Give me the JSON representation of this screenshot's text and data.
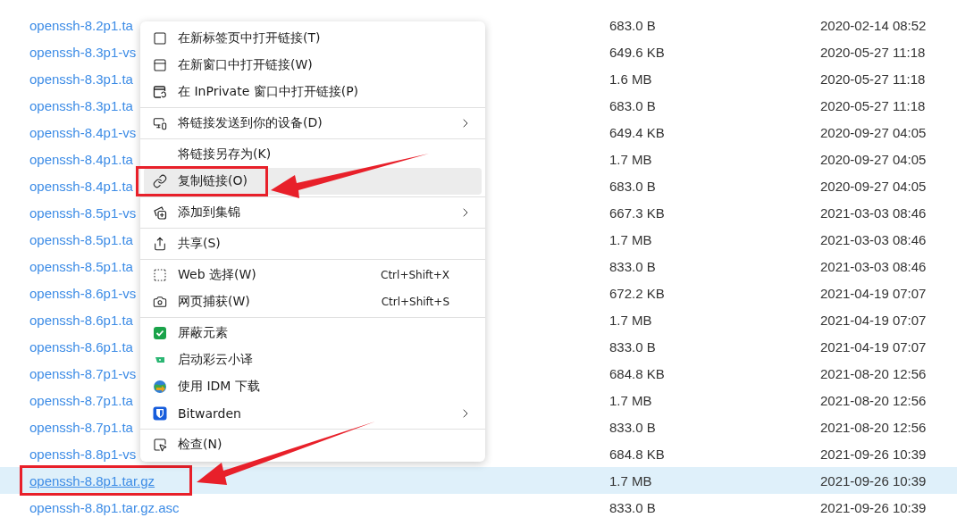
{
  "files": [
    {
      "name": "openssh-8.2p1.ta",
      "size": "683.0 B",
      "date": "2020-02-14 08:52",
      "selected": false
    },
    {
      "name": "openssh-8.3p1-vs",
      "size": "649.6 KB",
      "date": "2020-05-27 11:18",
      "selected": false
    },
    {
      "name": "openssh-8.3p1.ta",
      "size": "1.6 MB",
      "date": "2020-05-27 11:18",
      "selected": false
    },
    {
      "name": "openssh-8.3p1.ta",
      "size": "683.0 B",
      "date": "2020-05-27 11:18",
      "selected": false
    },
    {
      "name": "openssh-8.4p1-vs",
      "size": "649.4 KB",
      "date": "2020-09-27 04:05",
      "selected": false
    },
    {
      "name": "openssh-8.4p1.ta",
      "size": "1.7 MB",
      "date": "2020-09-27 04:05",
      "selected": false
    },
    {
      "name": "openssh-8.4p1.ta",
      "size": "683.0 B",
      "date": "2020-09-27 04:05",
      "selected": false
    },
    {
      "name": "openssh-8.5p1-vs",
      "size": "667.3 KB",
      "date": "2021-03-03 08:46",
      "selected": false
    },
    {
      "name": "openssh-8.5p1.ta",
      "size": "1.7 MB",
      "date": "2021-03-03 08:46",
      "selected": false
    },
    {
      "name": "openssh-8.5p1.ta",
      "size": "833.0 B",
      "date": "2021-03-03 08:46",
      "selected": false
    },
    {
      "name": "openssh-8.6p1-vs",
      "size": "672.2 KB",
      "date": "2021-04-19 07:07",
      "selected": false
    },
    {
      "name": "openssh-8.6p1.ta",
      "size": "1.7 MB",
      "date": "2021-04-19 07:07",
      "selected": false
    },
    {
      "name": "openssh-8.6p1.ta",
      "size": "833.0 B",
      "date": "2021-04-19 07:07",
      "selected": false
    },
    {
      "name": "openssh-8.7p1-vs",
      "size": "684.8 KB",
      "date": "2021-08-20 12:56",
      "selected": false
    },
    {
      "name": "openssh-8.7p1.ta",
      "size": "1.7 MB",
      "date": "2021-08-20 12:56",
      "selected": false
    },
    {
      "name": "openssh-8.7p1.ta",
      "size": "833.0 B",
      "date": "2021-08-20 12:56",
      "selected": false
    },
    {
      "name": "openssh-8.8p1-vs",
      "size": "684.8 KB",
      "date": "2021-09-26 10:39",
      "selected": false
    },
    {
      "name": "openssh-8.8p1.tar.gz",
      "size": "1.7 MB",
      "date": "2021-09-26 10:39",
      "selected": true
    },
    {
      "name": "openssh-8.8p1.tar.gz.asc",
      "size": "833.0 B",
      "date": "2021-09-26 10:39",
      "selected": false
    }
  ],
  "context_menu": {
    "sections": [
      [
        {
          "label": "在新标签页中打开链接(T)",
          "has_submenu": false,
          "selected": false
        },
        {
          "label": "在新窗口中打开链接(W)",
          "has_submenu": false,
          "selected": false
        },
        {
          "label": "在 InPrivate 窗口中打开链接(P)",
          "has_submenu": false,
          "selected": false
        }
      ],
      [
        {
          "label": "将链接发送到你的设备(D)",
          "has_submenu": true,
          "selected": false
        }
      ],
      [
        {
          "label": "将链接另存为(K)",
          "has_submenu": false,
          "selected": false
        },
        {
          "label": "复制链接(O)",
          "has_submenu": false,
          "selected": true
        }
      ],
      [
        {
          "label": "添加到集锦",
          "has_submenu": true,
          "selected": false
        }
      ],
      [
        {
          "label": "共享(S)",
          "has_submenu": false,
          "selected": false
        }
      ],
      [
        {
          "label": "Web 选择(W)",
          "shortcut": "Ctrl+Shift+X",
          "has_submenu": false,
          "selected": false
        },
        {
          "label": "网页捕获(W)",
          "shortcut": "Ctrl+Shift+S",
          "has_submenu": false,
          "selected": false
        }
      ],
      [
        {
          "label": "屏蔽元素",
          "has_submenu": false,
          "selected": false
        },
        {
          "label": "启动彩云小译",
          "has_submenu": false,
          "selected": false
        },
        {
          "label": "使用 IDM 下载",
          "has_submenu": false,
          "selected": false
        },
        {
          "label": "Bitwarden",
          "has_submenu": true,
          "selected": false
        }
      ],
      [
        {
          "label": "检查(N)",
          "has_submenu": false,
          "selected": false
        }
      ]
    ]
  }
}
